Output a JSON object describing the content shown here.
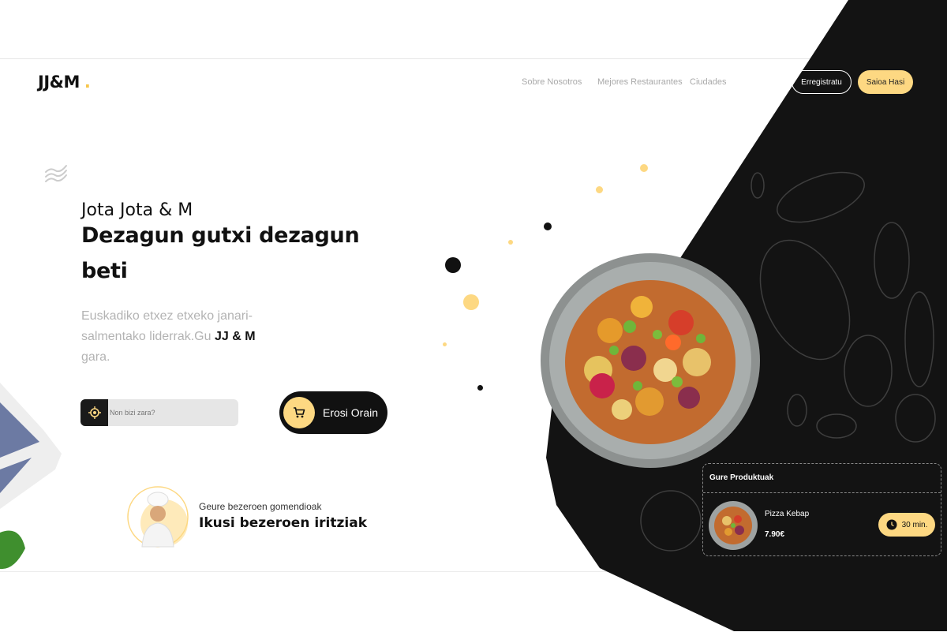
{
  "brand": {
    "logo": "JJ&M"
  },
  "nav": {
    "items": [
      "Sobre Nosotros",
      "Mejores Restaurantes",
      "Ciudades"
    ],
    "register_label": "Erregistratu",
    "login_label": "Saioa Hasi"
  },
  "hero": {
    "eyebrow": "Jota Jota & M",
    "title": "Dezagun gutxi dezagun beti",
    "description_prefix": "Euskadiko etxez etxeko janari-salmentako liderrak.Gu ",
    "description_brand": "JJ & M",
    "description_suffix": "gara."
  },
  "search": {
    "placeholder": "Non bizi zara?",
    "icon": "location-target-icon"
  },
  "cta": {
    "label": "Erosi Orain",
    "icon": "cart-icon"
  },
  "reviews": {
    "subtitle": "Geure bezeroen gomendioak",
    "title": "Ikusi bezeroen iritziak"
  },
  "products_card": {
    "title": "Gure Produktuak",
    "item": {
      "name": "Pizza Kebap",
      "price": "7.90€",
      "time": "30 min.",
      "time_icon": "clock-icon"
    }
  },
  "colors": {
    "accent": "#fdd882",
    "dark": "#131313",
    "muted": "#b3b3b3"
  }
}
